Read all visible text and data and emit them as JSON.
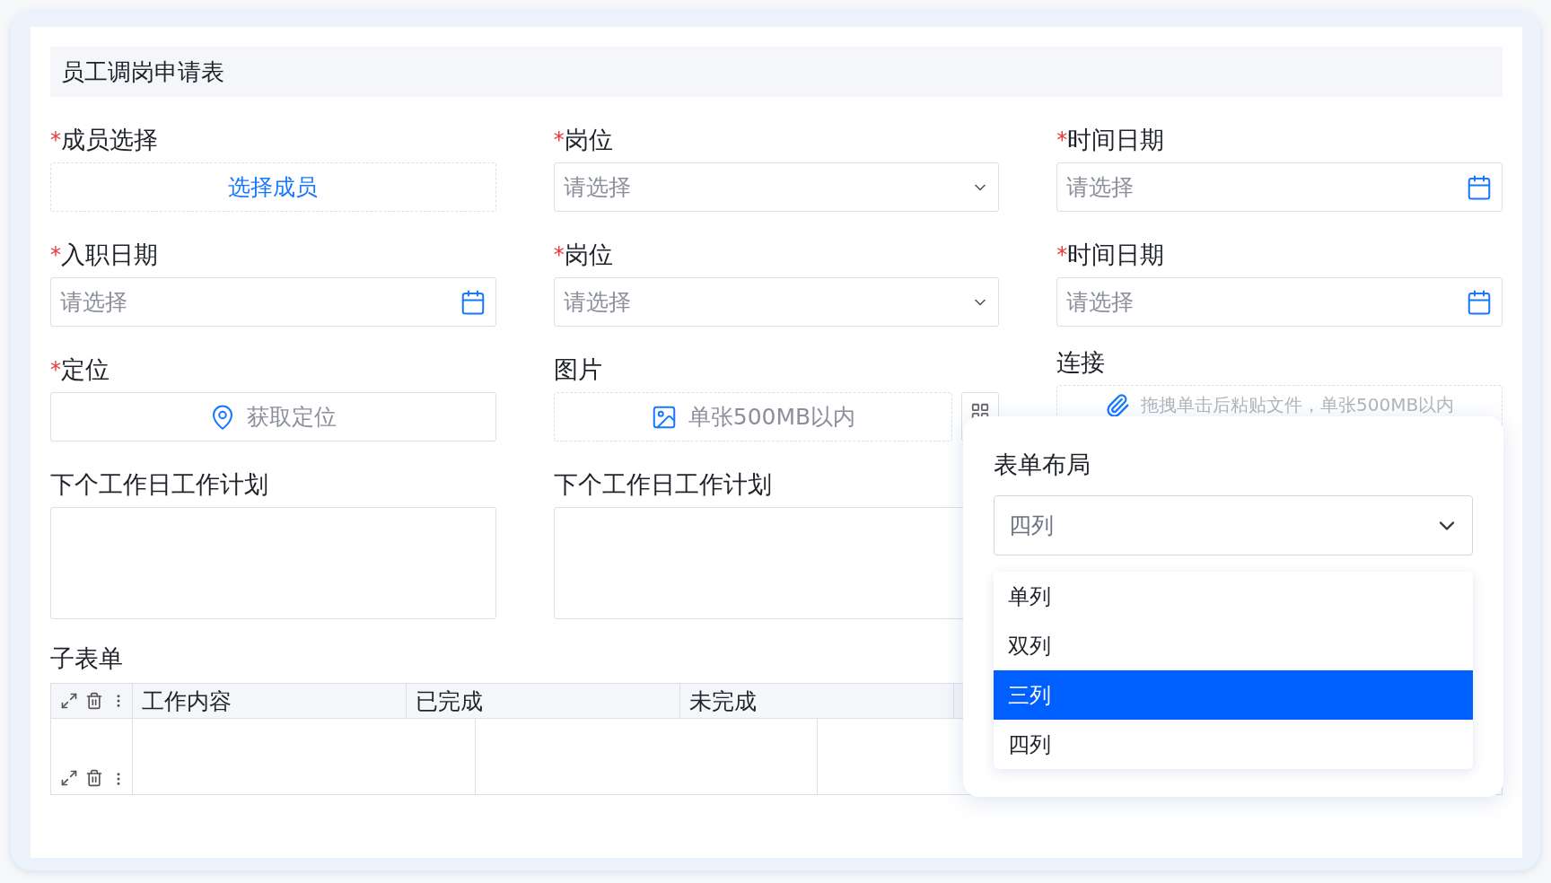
{
  "form": {
    "title": "员工调岗申请表",
    "fields": [
      {
        "kind": "member",
        "required_mark": "*",
        "label": "成员选择",
        "button_label": "选择成员"
      },
      {
        "kind": "select",
        "required_mark": "*",
        "label": "岗位",
        "placeholder": "请选择"
      },
      {
        "kind": "date",
        "required_mark": "*",
        "label": "时间日期",
        "placeholder": "请选择"
      },
      {
        "kind": "date",
        "required_mark": "*",
        "label": "入职日期",
        "placeholder": "请选择"
      },
      {
        "kind": "select",
        "required_mark": "*",
        "label": "岗位",
        "placeholder": "请选择"
      },
      {
        "kind": "date",
        "required_mark": "*",
        "label": "时间日期",
        "placeholder": "请选择"
      },
      {
        "kind": "location",
        "required_mark": "*",
        "label": "定位",
        "button_label": "获取定位"
      },
      {
        "kind": "image",
        "label": "图片",
        "hint": "单张500MB以内"
      },
      {
        "kind": "file",
        "label": "连接",
        "hint": "拖拽单击后粘贴文件，单张500MB以内"
      },
      {
        "kind": "textarea",
        "label": "下个工作日工作计划"
      },
      {
        "kind": "textarea",
        "label": "下个工作日工作计划"
      }
    ],
    "subform": {
      "label": "子表单",
      "columns": [
        "工作内容",
        "已完成",
        "未完成"
      ]
    }
  },
  "layout_popup": {
    "title": "表单布局",
    "select": {
      "value": "四列",
      "expanded": true
    },
    "options": [
      {
        "label": "单列",
        "selected": false
      },
      {
        "label": "双列",
        "selected": false
      },
      {
        "label": "三列",
        "selected": true
      },
      {
        "label": "四列",
        "selected": false
      }
    ]
  }
}
